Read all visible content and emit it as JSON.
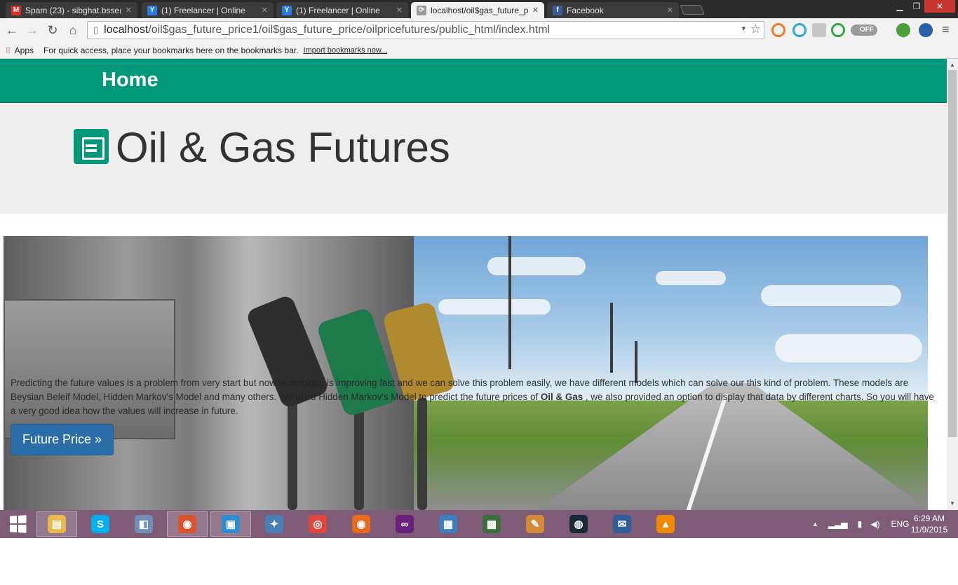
{
  "browser": {
    "tabs": [
      {
        "label": "Spam (23) - sibghat.bsse@",
        "icon": "gmail-icon",
        "color": "#d93025"
      },
      {
        "label": "(1) Freelancer | Online",
        "icon": "freelancer-icon",
        "color": "#2a7ae4"
      },
      {
        "label": "(1) Freelancer | Online",
        "icon": "freelancer-icon",
        "color": "#2a7ae4"
      },
      {
        "label": "localhost/oil$gas_future_p",
        "icon": "page-icon",
        "color": "#777777"
      },
      {
        "label": "Facebook",
        "icon": "facebook-icon",
        "color": "#3b5998"
      }
    ],
    "address": {
      "host": "localhost",
      "path": "/oil$gas_future_price1/oil$gas_future_price/oilpricefutures/public_html/index.html"
    },
    "bookmarks_bar": {
      "apps_label": "Apps",
      "hint": "For quick access, place your bookmarks here on the bookmarks bar.",
      "import_link": "Import bookmarks now..."
    },
    "extension_toggle": "OFF"
  },
  "page": {
    "nav_home": "Home",
    "title": "Oil & Gas Futures",
    "banner": {
      "text_before": "Predicting the future values is a problem from very start but now technology is improving fast and we can solve this problem easily, we have different models which can solve our this kind of problem. These models are Beysian Beleif Model, Hidden Markov's Model and many others. We used Hidden Markov's Model to predict the future prices of",
      "text_bold": "Oil & Gas",
      "text_after": ", we also provided an option to display that data by different charts. So you will have a very good idea how the values will increase in future.",
      "button": "Future Price »"
    }
  },
  "taskbar": {
    "apps": [
      {
        "name": "file-explorer-icon",
        "color": "#e8b84a",
        "glyph": "▤"
      },
      {
        "name": "skype-icon",
        "color": "#00aff0",
        "glyph": "S"
      },
      {
        "name": "virtualbox-icon",
        "color": "#6f8fb8",
        "glyph": "◧"
      },
      {
        "name": "firefox-dev-icon",
        "color": "#d9532c",
        "glyph": "◉"
      },
      {
        "name": "sublime-icon",
        "color": "#2c8fd6",
        "glyph": "▣"
      },
      {
        "name": "safari-icon",
        "color": "#4a7fb5",
        "glyph": "✦"
      },
      {
        "name": "chrome-icon",
        "color": "#e0463c",
        "glyph": "◎"
      },
      {
        "name": "firefox-icon",
        "color": "#e66b1e",
        "glyph": "◉"
      },
      {
        "name": "visual-studio-icon",
        "color": "#68217a",
        "glyph": "∞"
      },
      {
        "name": "remote-desktop-icon",
        "color": "#3d7fc1",
        "glyph": "▦"
      },
      {
        "name": "game-icon",
        "color": "#3a6e3a",
        "glyph": "▩"
      },
      {
        "name": "paint-icon",
        "color": "#d08a3a",
        "glyph": "✎"
      },
      {
        "name": "steam-icon",
        "color": "#1b2838",
        "glyph": "◍"
      },
      {
        "name": "thunderbird-icon",
        "color": "#2f5d99",
        "glyph": "✉"
      },
      {
        "name": "vlc-icon",
        "color": "#f08a00",
        "glyph": "▲"
      }
    ],
    "language": "ENG",
    "time": "6:29 AM",
    "date": "11/9/2015"
  }
}
